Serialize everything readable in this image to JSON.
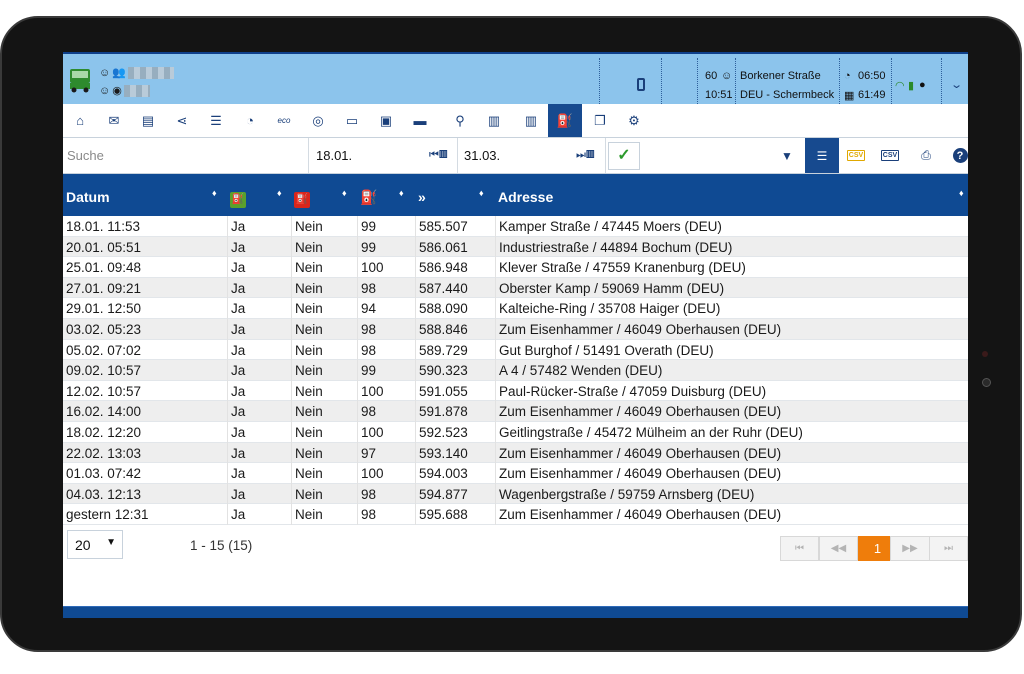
{
  "colors": {
    "accent": "#0f4a93",
    "statusbar": "#8cc4ec",
    "current_page": "#ef7d0b",
    "ok": "#2c9a2c"
  },
  "statusbar": {
    "speed": "60",
    "time_rest": "10:51",
    "location_street": "Borkener Straße",
    "location_region": "DEU - Schermbeck",
    "clock_time": "06:50",
    "remaining": "61:49",
    "icons": [
      "truck-icon",
      "driver-smiley-icon",
      "team-icon",
      "phone-icon",
      "signal-icon",
      "battery-icon",
      "person-icon",
      "chevron-down-icon"
    ]
  },
  "toolbar": {
    "items": [
      "home-icon",
      "mail-icon",
      "clipboard-icon",
      "share-icon",
      "list-icon",
      "speedometer-icon",
      "eco-icon",
      "rfid-icon",
      "keyboard-icon",
      "document-icon",
      "truck-side-icon",
      "route-icon",
      "card-icon",
      "card-alt-icon",
      "fuel-icon",
      "copy-icon",
      "settings-icon"
    ],
    "eco_label": "eco"
  },
  "filter": {
    "search_placeholder": "Suche",
    "date_from": "18.01.",
    "date_to": "31.03."
  },
  "table": {
    "headers": [
      "Datum",
      "",
      "",
      "",
      "»",
      "Adresse"
    ],
    "rows": [
      [
        "18.01. 11:53",
        "Ja",
        "Nein",
        "99",
        "585.507",
        "Kamper Straße / 47445 Moers (DEU)"
      ],
      [
        "20.01. 05:51",
        "Ja",
        "Nein",
        "99",
        "586.061",
        "Industriestraße / 44894 Bochum (DEU)"
      ],
      [
        "25.01. 09:48",
        "Ja",
        "Nein",
        "100",
        "586.948",
        "Klever Straße / 47559 Kranenburg (DEU)"
      ],
      [
        "27.01. 09:21",
        "Ja",
        "Nein",
        "98",
        "587.440",
        "Oberster Kamp / 59069 Hamm (DEU)"
      ],
      [
        "29.01. 12:50",
        "Ja",
        "Nein",
        "94",
        "588.090",
        "Kalteiche-Ring / 35708 Haiger (DEU)"
      ],
      [
        "03.02. 05:23",
        "Ja",
        "Nein",
        "98",
        "588.846",
        "Zum Eisenhammer / 46049 Oberhausen (DEU)"
      ],
      [
        "05.02. 07:02",
        "Ja",
        "Nein",
        "98",
        "589.729",
        "Gut Burghof / 51491 Overath (DEU)"
      ],
      [
        "09.02. 10:57",
        "Ja",
        "Nein",
        "99",
        "590.323",
        "A 4 / 57482 Wenden (DEU)"
      ],
      [
        "12.02. 10:57",
        "Ja",
        "Nein",
        "100",
        "591.055",
        "Paul-Rücker-Straße / 47059 Duisburg (DEU)"
      ],
      [
        "16.02. 14:00",
        "Ja",
        "Nein",
        "98",
        "591.878",
        "Zum Eisenhammer / 46049 Oberhausen (DEU)"
      ],
      [
        "18.02. 12:20",
        "Ja",
        "Nein",
        "100",
        "592.523",
        "Geitlingstraße / 45472 Mülheim an der Ruhr (DEU)"
      ],
      [
        "22.02. 13:03",
        "Ja",
        "Nein",
        "97",
        "593.140",
        "Zum Eisenhammer / 46049 Oberhausen (DEU)"
      ],
      [
        "01.03. 07:42",
        "Ja",
        "Nein",
        "100",
        "594.003",
        "Zum Eisenhammer / 46049 Oberhausen (DEU)"
      ],
      [
        "04.03. 12:13",
        "Ja",
        "Nein",
        "98",
        "594.877",
        "Wagenbergstraße / 59759 Arnsberg (DEU)"
      ],
      [
        "gestern 12:31",
        "Ja",
        "Nein",
        "98",
        "595.688",
        "Zum Eisenhammer / 46049 Oberhausen (DEU)"
      ]
    ]
  },
  "pager": {
    "page_size": "20",
    "info": "1 - 15 (15)",
    "current_page": "1"
  }
}
